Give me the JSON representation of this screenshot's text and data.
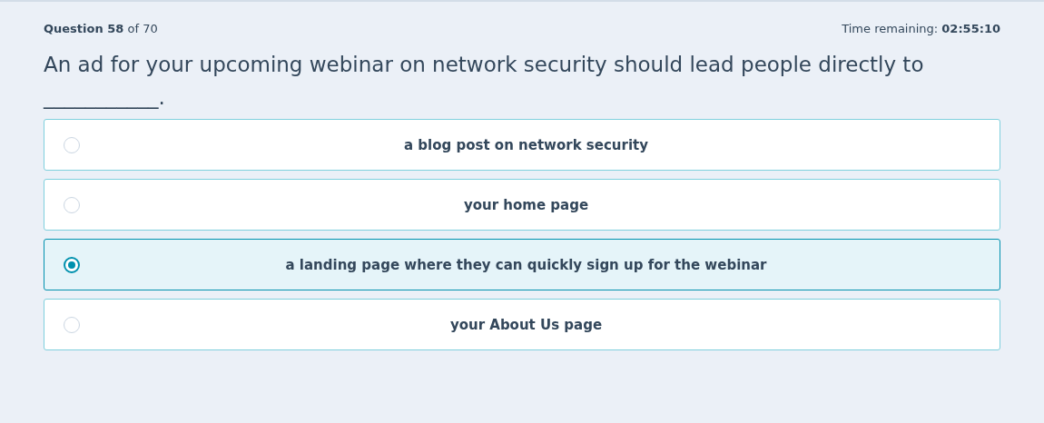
{
  "progress": "**Question 58** of 70",
  "timer": "Time remaining: **02:55:10**",
  "question": "An ad for your upcoming webinar on network security should lead people directly to ___________.",
  "options": [
    {
      "label": "a blog post on network security",
      "selected": false
    },
    {
      "label": "your home page",
      "selected": false
    },
    {
      "label": "a landing page where they can quickly sign up for the webinar",
      "selected": true
    },
    {
      "label": "your About Us page",
      "selected": false
    }
  ]
}
